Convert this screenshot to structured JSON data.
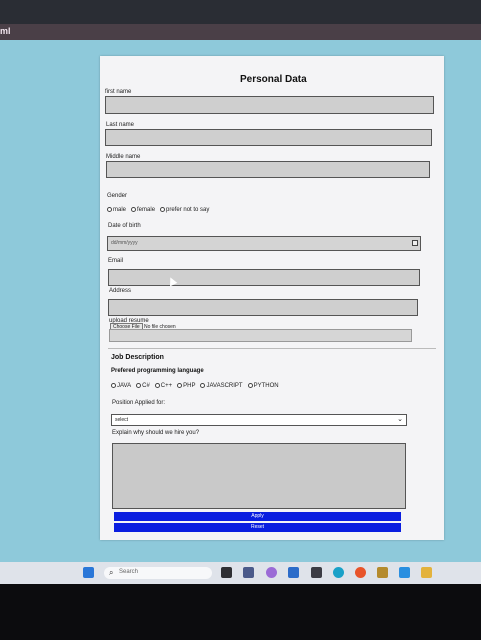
{
  "window": {
    "title_fragment": "ml"
  },
  "form": {
    "title": "Personal Data",
    "first_name_label": "first name",
    "last_name_label": "Last name",
    "middle_name_label": "Middle name",
    "gender_label": "Gender",
    "gender_options": [
      "male",
      "female",
      "prefer not to say"
    ],
    "dob_label": "Date of birth",
    "dob_placeholder": "dd/mm/yyyy",
    "email_label": "Email",
    "address_label": "Address",
    "resume_label": "upload resume",
    "choose_file": "Choose File",
    "no_file": "No file chosen",
    "job_heading": "Job Description",
    "lang_label": "Prefered programming language",
    "languages": [
      "JAVA",
      "C#",
      "C++",
      "PHP",
      "JAVASCRIPT",
      "PYTHON"
    ],
    "position_label": "Position Applied for:",
    "position_value": "select",
    "explain_label": "Explain why should we hire you?",
    "apply_label": "Apply",
    "reset_label": "Reset"
  },
  "taskbar": {
    "search_placeholder": "Search"
  },
  "colors": {
    "page_bg": "#8ec9da",
    "button": "#0a1ee0",
    "field": "#cfcfcf"
  }
}
